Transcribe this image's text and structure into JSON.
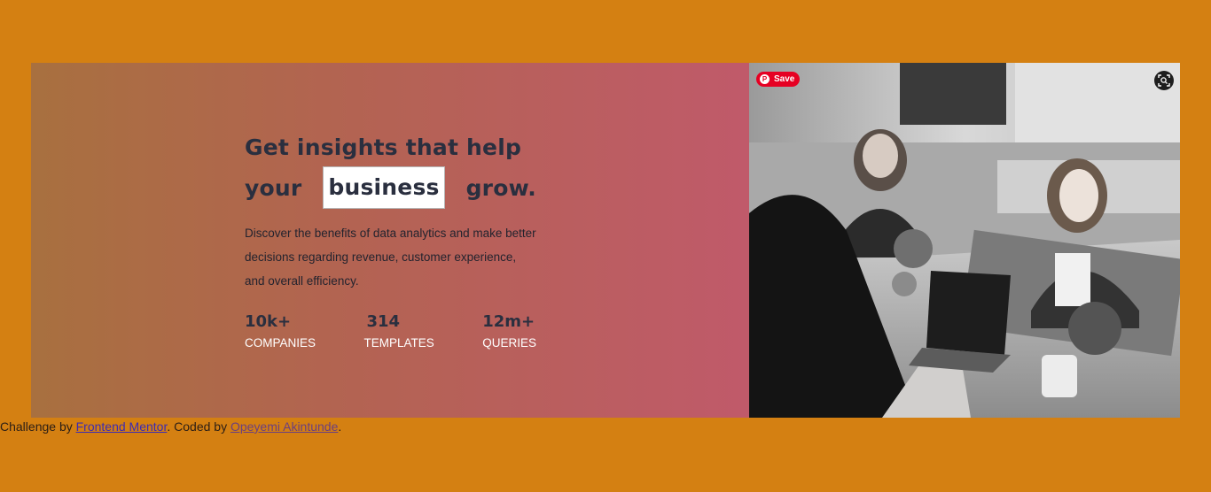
{
  "hero": {
    "headline_line1": "Get insights that help",
    "headline_word_your": "your",
    "headline_highlight": "business",
    "headline_word_grow": "grow.",
    "description": "Discover the benefits of data analytics and make better decisions regarding revenue, customer experience, and overall efficiency.",
    "stats": [
      {
        "value": "10k+",
        "label": "COMPANIES"
      },
      {
        "value": "314",
        "label": "TEMPLATES"
      },
      {
        "value": "12m+",
        "label": "QUERIES"
      }
    ]
  },
  "image_overlay": {
    "save_label": "Save",
    "pin_icon": "pinterest-icon",
    "lens_icon": "visual-search-icon"
  },
  "footer": {
    "prefix": "Challenge by ",
    "fm_link": "Frontend Mentor",
    "middle": ". Coded by ",
    "author_link": "Opeyemi Akintunde",
    "suffix": "."
  },
  "colors": {
    "page_background": "#d48012",
    "heading": "#2a2f3f",
    "stat_label": "#ffffff",
    "pinterest_red": "#e60023"
  }
}
